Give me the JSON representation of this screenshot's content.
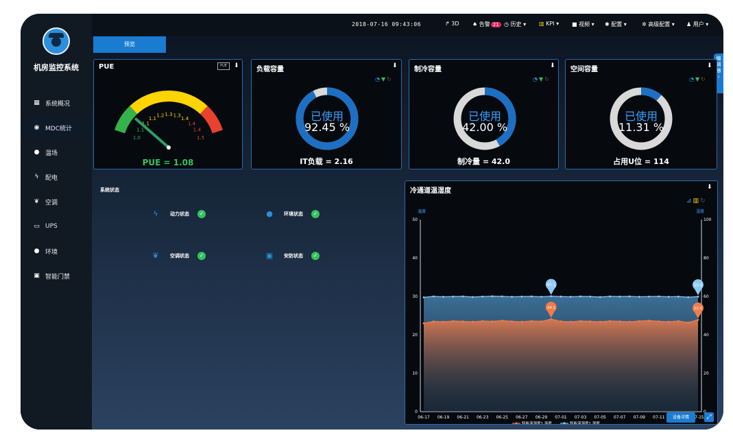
{
  "sidebar": {
    "app_title": "机房监控系统",
    "items": [
      {
        "label": "系统概况",
        "icon": "grid-icon"
      },
      {
        "label": "MDC统计",
        "icon": "eye-icon"
      },
      {
        "label": "温场",
        "icon": "drop-icon"
      },
      {
        "label": "配电",
        "icon": "bolt-icon"
      },
      {
        "label": "空调",
        "icon": "leaf-icon"
      },
      {
        "label": "UPS",
        "icon": "battery-icon"
      },
      {
        "label": "环境",
        "icon": "drop-icon"
      },
      {
        "label": "智能门禁",
        "icon": "door-icon"
      }
    ]
  },
  "topbar": {
    "datetime": "2018-07-16 09:43:06",
    "items": [
      {
        "label": "↱ 3D",
        "icon": "share-icon"
      },
      {
        "label": "告警",
        "badge": "21",
        "icon": "bell-icon"
      },
      {
        "label": "历史 ▾",
        "icon": "history-icon"
      },
      {
        "label": "KPI ▾",
        "icon": "chart-icon"
      },
      {
        "label": "视频 ▾",
        "icon": "video-icon"
      },
      {
        "label": "配置 ▾",
        "icon": "gear-icon"
      },
      {
        "label": "高级配置 ▾",
        "icon": "gears-icon"
      },
      {
        "label": "用户 ▾",
        "icon": "user-icon"
      }
    ]
  },
  "preview_button": "预览",
  "side_tab": "编辑器",
  "panels": {
    "pue": {
      "title": "PUE",
      "box_label": "PUE",
      "value_text": "PUE = 1.08",
      "gauge": {
        "value": 1.08,
        "min": 1.0,
        "max": 1.5,
        "tick_labels": [
          "1.0",
          "1.1",
          "1.1",
          "1.1",
          "1.2",
          "1.3",
          "1.3",
          "1.4",
          "1.4",
          "1.4",
          "1.5"
        ]
      }
    },
    "load": {
      "title": "负载容量",
      "used_label": "已使用",
      "percent_text": "92.45 %",
      "percent": 92.45,
      "footer": "IT负载 = 2.16"
    },
    "cooling": {
      "title": "制冷容量",
      "used_label": "已使用",
      "percent_text": "42.00 %",
      "percent": 42.0,
      "footer": "制冷量 = 42.0"
    },
    "space": {
      "title": "空间容量",
      "used_label": "已使用",
      "percent_text": "11.31 %",
      "percent": 11.31,
      "footer": "占用U位 = 114"
    }
  },
  "system_status": {
    "title": "系统状态",
    "items": [
      {
        "label": "动力状态",
        "icon": "bolt-icon"
      },
      {
        "label": "环境状态",
        "icon": "drop-icon"
      },
      {
        "label": "空调状态",
        "icon": "leaf-icon"
      },
      {
        "label": "安防状态",
        "icon": "door-icon"
      }
    ]
  },
  "chart_panel": {
    "title": "冷通道温湿度",
    "detail_button": "设备详情"
  },
  "chart_data": {
    "type": "area",
    "title": "冷通道温湿度",
    "ylabel_left": "温度",
    "ylabel_right": "湿度",
    "ylim_left": [
      0,
      50
    ],
    "ylim_right": [
      0,
      100
    ],
    "y_ticks_left": [
      "0",
      "10",
      "20",
      "30",
      "40",
      "50"
    ],
    "y_ticks_right": [
      "0",
      "20",
      "40",
      "60",
      "80",
      "100"
    ],
    "x_tick_labels": [
      "06-17",
      "06-19",
      "06-21",
      "06-23",
      "06-25",
      "06-27",
      "06-29",
      "07-01",
      "07-03",
      "07-05",
      "07-07",
      "07-09",
      "07-11",
      "07-13",
      "07-15"
    ],
    "x_count": 29,
    "series": [
      {
        "name": "智能温湿度1 温度",
        "axis": "left",
        "color": "#f07c4a",
        "values": [
          23.0,
          23.5,
          23.4,
          23.6,
          23.5,
          23.4,
          23.6,
          23.5,
          23.7,
          23.5,
          23.4,
          23.6,
          23.5,
          24.1,
          23.5,
          23.4,
          23.6,
          23.5,
          23.4,
          23.6,
          23.5,
          23.4,
          23.6,
          23.7,
          23.5,
          23.4,
          23.6,
          23.2,
          23.9
        ],
        "marks": [
          {
            "index": 13,
            "label": "24.1"
          },
          {
            "index": 28,
            "label": "22.5"
          }
        ]
      },
      {
        "name": "智能温湿度1 湿度",
        "axis": "right",
        "color": "#8ec9f3",
        "values": [
          59.5,
          60.0,
          59.8,
          59.9,
          60.0,
          59.7,
          59.9,
          60.1,
          60.0,
          59.8,
          59.9,
          60.0,
          59.8,
          60.1,
          59.9,
          59.8,
          60.0,
          59.9,
          59.7,
          60.0,
          59.9,
          60.0,
          59.8,
          59.9,
          60.0,
          59.8,
          59.9,
          59.6,
          59.9
        ],
        "marks": [
          {
            "index": 13,
            "label": "60.1"
          },
          {
            "index": 28,
            "label": "59.9"
          }
        ]
      }
    ],
    "legend": "bottom",
    "grid": false
  }
}
